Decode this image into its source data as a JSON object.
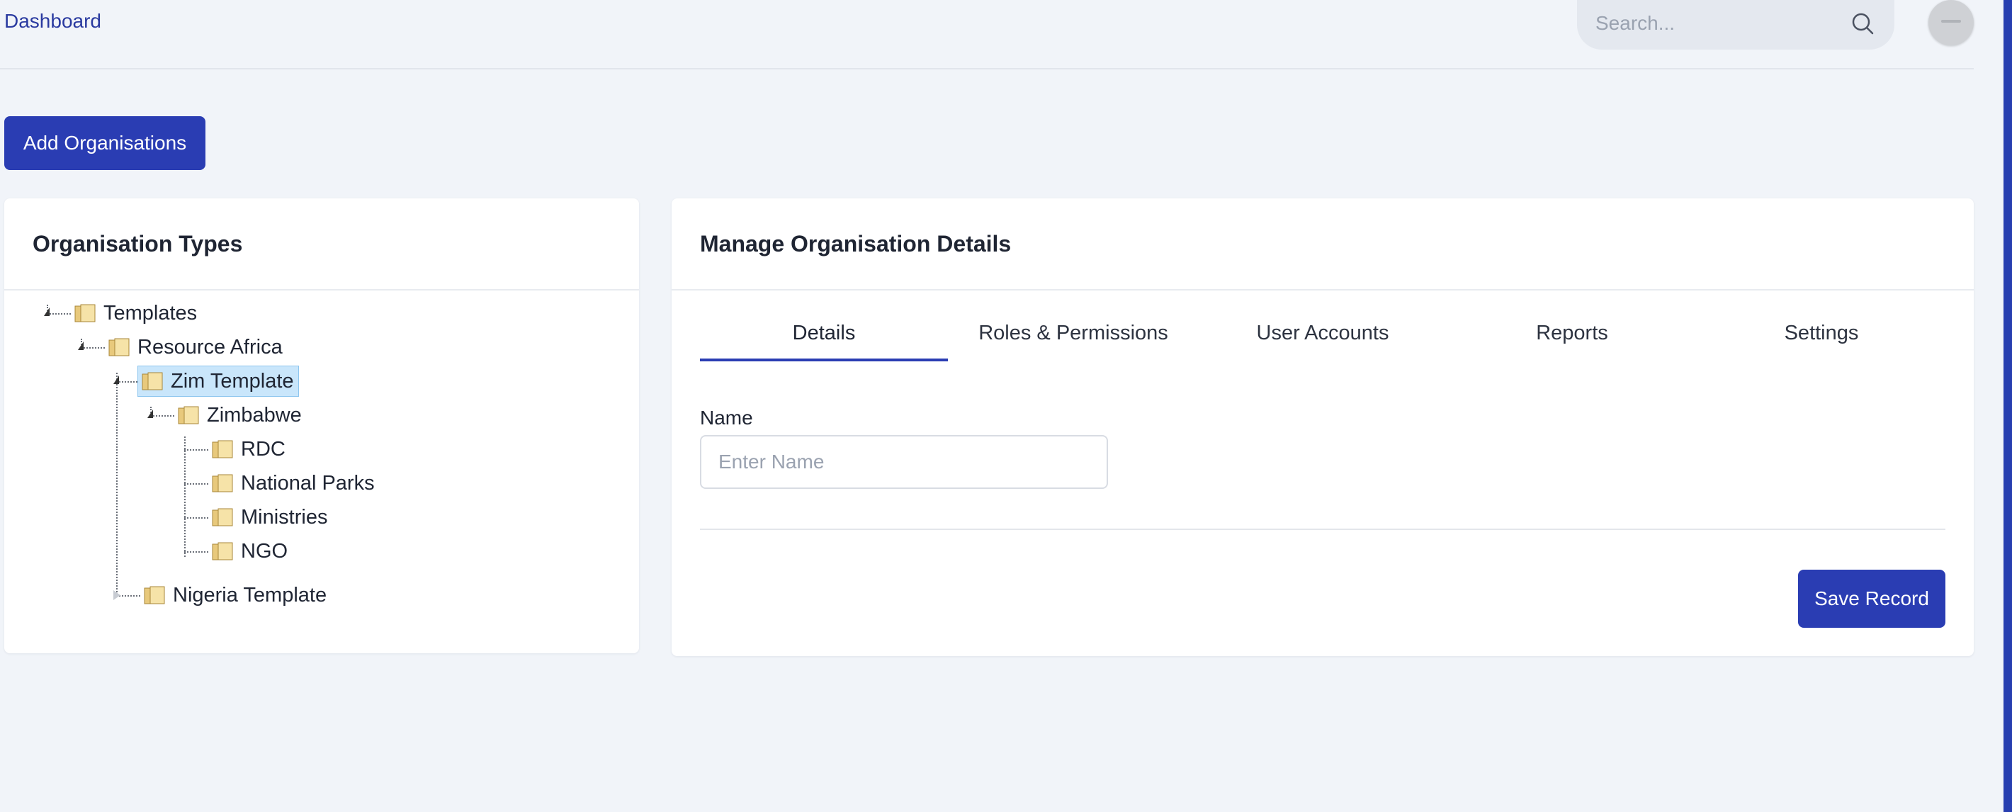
{
  "header": {
    "breadcrumb": "Dashboard",
    "search_placeholder": "Search...",
    "search_icon": "search-icon",
    "avatar_icon": "user-avatar"
  },
  "actions": {
    "add_label": "Add Organisations"
  },
  "org_types": {
    "title": "Organisation Types",
    "tree": [
      {
        "label": "Templates"
      },
      {
        "label": "Resource Africa"
      },
      {
        "label": "Zim Template",
        "selected": true
      },
      {
        "label": "Zimbabwe"
      },
      {
        "label": "RDC"
      },
      {
        "label": "National Parks"
      },
      {
        "label": "Ministries"
      },
      {
        "label": "NGO"
      },
      {
        "label": "Nigeria Template"
      }
    ]
  },
  "details": {
    "title": "Manage Organisation Details",
    "tabs": [
      {
        "label": "Details",
        "active": true
      },
      {
        "label": "Roles & Permissions"
      },
      {
        "label": "User Accounts"
      },
      {
        "label": "Reports"
      },
      {
        "label": "Settings"
      }
    ],
    "name_label": "Name",
    "name_placeholder": "Enter Name",
    "name_value": "",
    "save_label": "Save Record"
  },
  "colors": {
    "primary": "#2a3db3",
    "background": "#f1f4f9",
    "selected_node": "#c9e6fb"
  }
}
